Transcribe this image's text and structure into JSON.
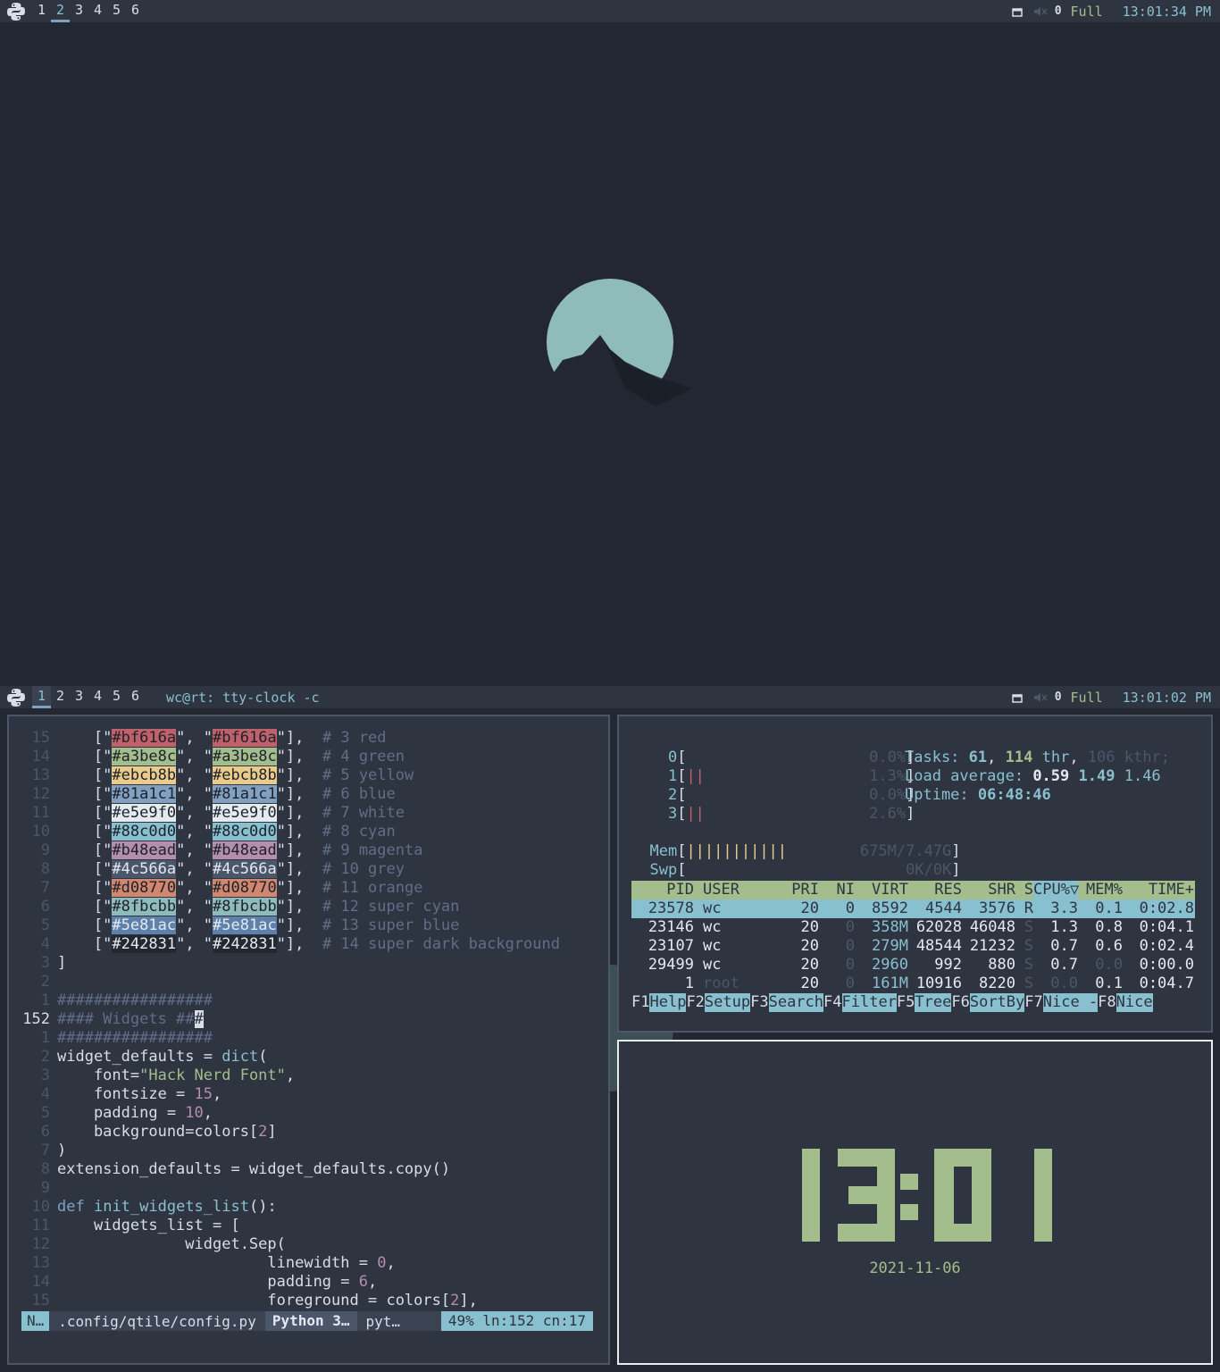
{
  "top_bar": {
    "workspaces": [
      "1",
      "2",
      "3",
      "4",
      "5",
      "6"
    ],
    "active": "2",
    "layout": "Full",
    "clock": "13:01:34 PM",
    "volume_label": "0"
  },
  "bottom_bar": {
    "workspaces": [
      "1",
      "2",
      "3",
      "4",
      "5",
      "6"
    ],
    "active": "1",
    "window_title": "wc@rt: tty-clock -c",
    "layout": "Full",
    "clock": "13:01:02 PM",
    "volume_label": "0"
  },
  "editor": {
    "colors": [
      {
        "num": "15",
        "hex": "#bf616a",
        "comment": "# 3 red"
      },
      {
        "num": "14",
        "hex": "#a3be8c",
        "comment": "# 4 green"
      },
      {
        "num": "13",
        "hex": "#ebcb8b",
        "comment": "# 5 yellow"
      },
      {
        "num": "12",
        "hex": "#81a1c1",
        "comment": "# 6 blue"
      },
      {
        "num": "11",
        "hex": "#e5e9f0",
        "comment": "# 7 white"
      },
      {
        "num": "10",
        "hex": "#88c0d0",
        "comment": "# 8 cyan"
      },
      {
        "num": "9",
        "hex": "#b48ead",
        "comment": "# 9 magenta"
      },
      {
        "num": "8",
        "hex": "#4c566a",
        "comment": "# 10 grey"
      },
      {
        "num": "7",
        "hex": "#d08770",
        "comment": "# 11 orange"
      },
      {
        "num": "6",
        "hex": "#8fbcbb",
        "comment": "# 12 super cyan"
      },
      {
        "num": "5",
        "hex": "#5e81ac",
        "comment": "# 13 super blue"
      },
      {
        "num": "4",
        "hex": "#242831",
        "comment": "# 14 super dark background"
      }
    ],
    "lines": [
      {
        "num": "3",
        "code": "]"
      },
      {
        "num": "2",
        "code": ""
      },
      {
        "num": "1",
        "code": "#################"
      },
      {
        "num": "152",
        "code": "#### Widgets ###"
      },
      {
        "num": "1",
        "code": "#################"
      },
      {
        "num": "2",
        "code": "widget_defaults = dict("
      },
      {
        "num": "3",
        "code": "    font=\"Hack Nerd Font\","
      },
      {
        "num": "4",
        "code": "    fontsize = 15,"
      },
      {
        "num": "5",
        "code": "    padding = 10,"
      },
      {
        "num": "6",
        "code": "    background=colors[2]"
      },
      {
        "num": "7",
        "code": ")"
      },
      {
        "num": "8",
        "code": "extension_defaults = widget_defaults.copy()"
      },
      {
        "num": "9",
        "code": ""
      },
      {
        "num": "10",
        "code": "def init_widgets_list():"
      },
      {
        "num": "11",
        "code": "    widgets_list = ["
      },
      {
        "num": "12",
        "code": "              widget.Sep("
      },
      {
        "num": "13",
        "code": "                       linewidth = 0,"
      },
      {
        "num": "14",
        "code": "                       padding = 6,"
      },
      {
        "num": "15",
        "code": "                       foreground = colors[2],"
      }
    ],
    "status": {
      "mode": "N…",
      "file": ".config/qtile/config.py",
      "filetype": "Python 3…",
      "filetype2": "pyt…",
      "position": "49% ln:152 cn:17"
    }
  },
  "htop": {
    "cpus": [
      {
        "id": "0",
        "pct": "0.0%"
      },
      {
        "id": "1",
        "pct": "1.3%"
      },
      {
        "id": "2",
        "pct": "0.0%"
      },
      {
        "id": "3",
        "pct": "2.6%"
      }
    ],
    "mem": "675M/7.47G",
    "swp": "0K/0K",
    "tasks_label": "Tasks:",
    "tasks": "61",
    "thr": "114",
    "thr_label": "thr",
    "kthr": "106",
    "kthr_label": "kthr;",
    "load_label": "Load average:",
    "load1": "0.59",
    "load5": "1.49",
    "load15": "1.46",
    "uptime_label": "Uptime:",
    "uptime": "06:48:46",
    "columns": [
      "PID",
      "USER",
      "PRI",
      "NI",
      "VIRT",
      "RES",
      "SHR",
      "S",
      "CPU%▽",
      "MEM%",
      "TIME+"
    ],
    "processes": [
      {
        "pid": "23578",
        "user": "wc",
        "pri": "20",
        "ni": "0",
        "virt": "8592",
        "res": "4544",
        "shr": "3576",
        "s": "R",
        "cpu": "3.3",
        "mem": "0.1",
        "time": "0:02.8"
      },
      {
        "pid": "23146",
        "user": "wc",
        "pri": "20",
        "ni": "0",
        "virt": "358M",
        "res": "62028",
        "shr": "46048",
        "s": "S",
        "cpu": "1.3",
        "mem": "0.8",
        "time": "0:04.1"
      },
      {
        "pid": "23107",
        "user": "wc",
        "pri": "20",
        "ni": "0",
        "virt": "279M",
        "res": "48544",
        "shr": "21232",
        "s": "S",
        "cpu": "0.7",
        "mem": "0.6",
        "time": "0:02.4"
      },
      {
        "pid": "29499",
        "user": "wc",
        "pri": "20",
        "ni": "0",
        "virt": "2960",
        "res": "992",
        "shr": "880",
        "s": "S",
        "cpu": "0.7",
        "mem": "0.0",
        "time": "0:00.0"
      },
      {
        "pid": "1",
        "user": "root",
        "pri": "20",
        "ni": "0",
        "virt": "161M",
        "res": "10916",
        "shr": "8220",
        "s": "S",
        "cpu": "0.0",
        "mem": "0.1",
        "time": "0:04.7"
      }
    ],
    "fkeys": [
      {
        "key": "F1",
        "label": "Help  "
      },
      {
        "key": "F2",
        "label": "Setup "
      },
      {
        "key": "F3",
        "label": "Search"
      },
      {
        "key": "F4",
        "label": "Filter"
      },
      {
        "key": "F5",
        "label": "Tree  "
      },
      {
        "key": "F6",
        "label": "SortBy"
      },
      {
        "key": "F7",
        "label": "Nice -"
      },
      {
        "key": "F8",
        "label": "Nice "
      }
    ]
  },
  "clock": {
    "time": "13:01",
    "date": "2021-11-06"
  }
}
